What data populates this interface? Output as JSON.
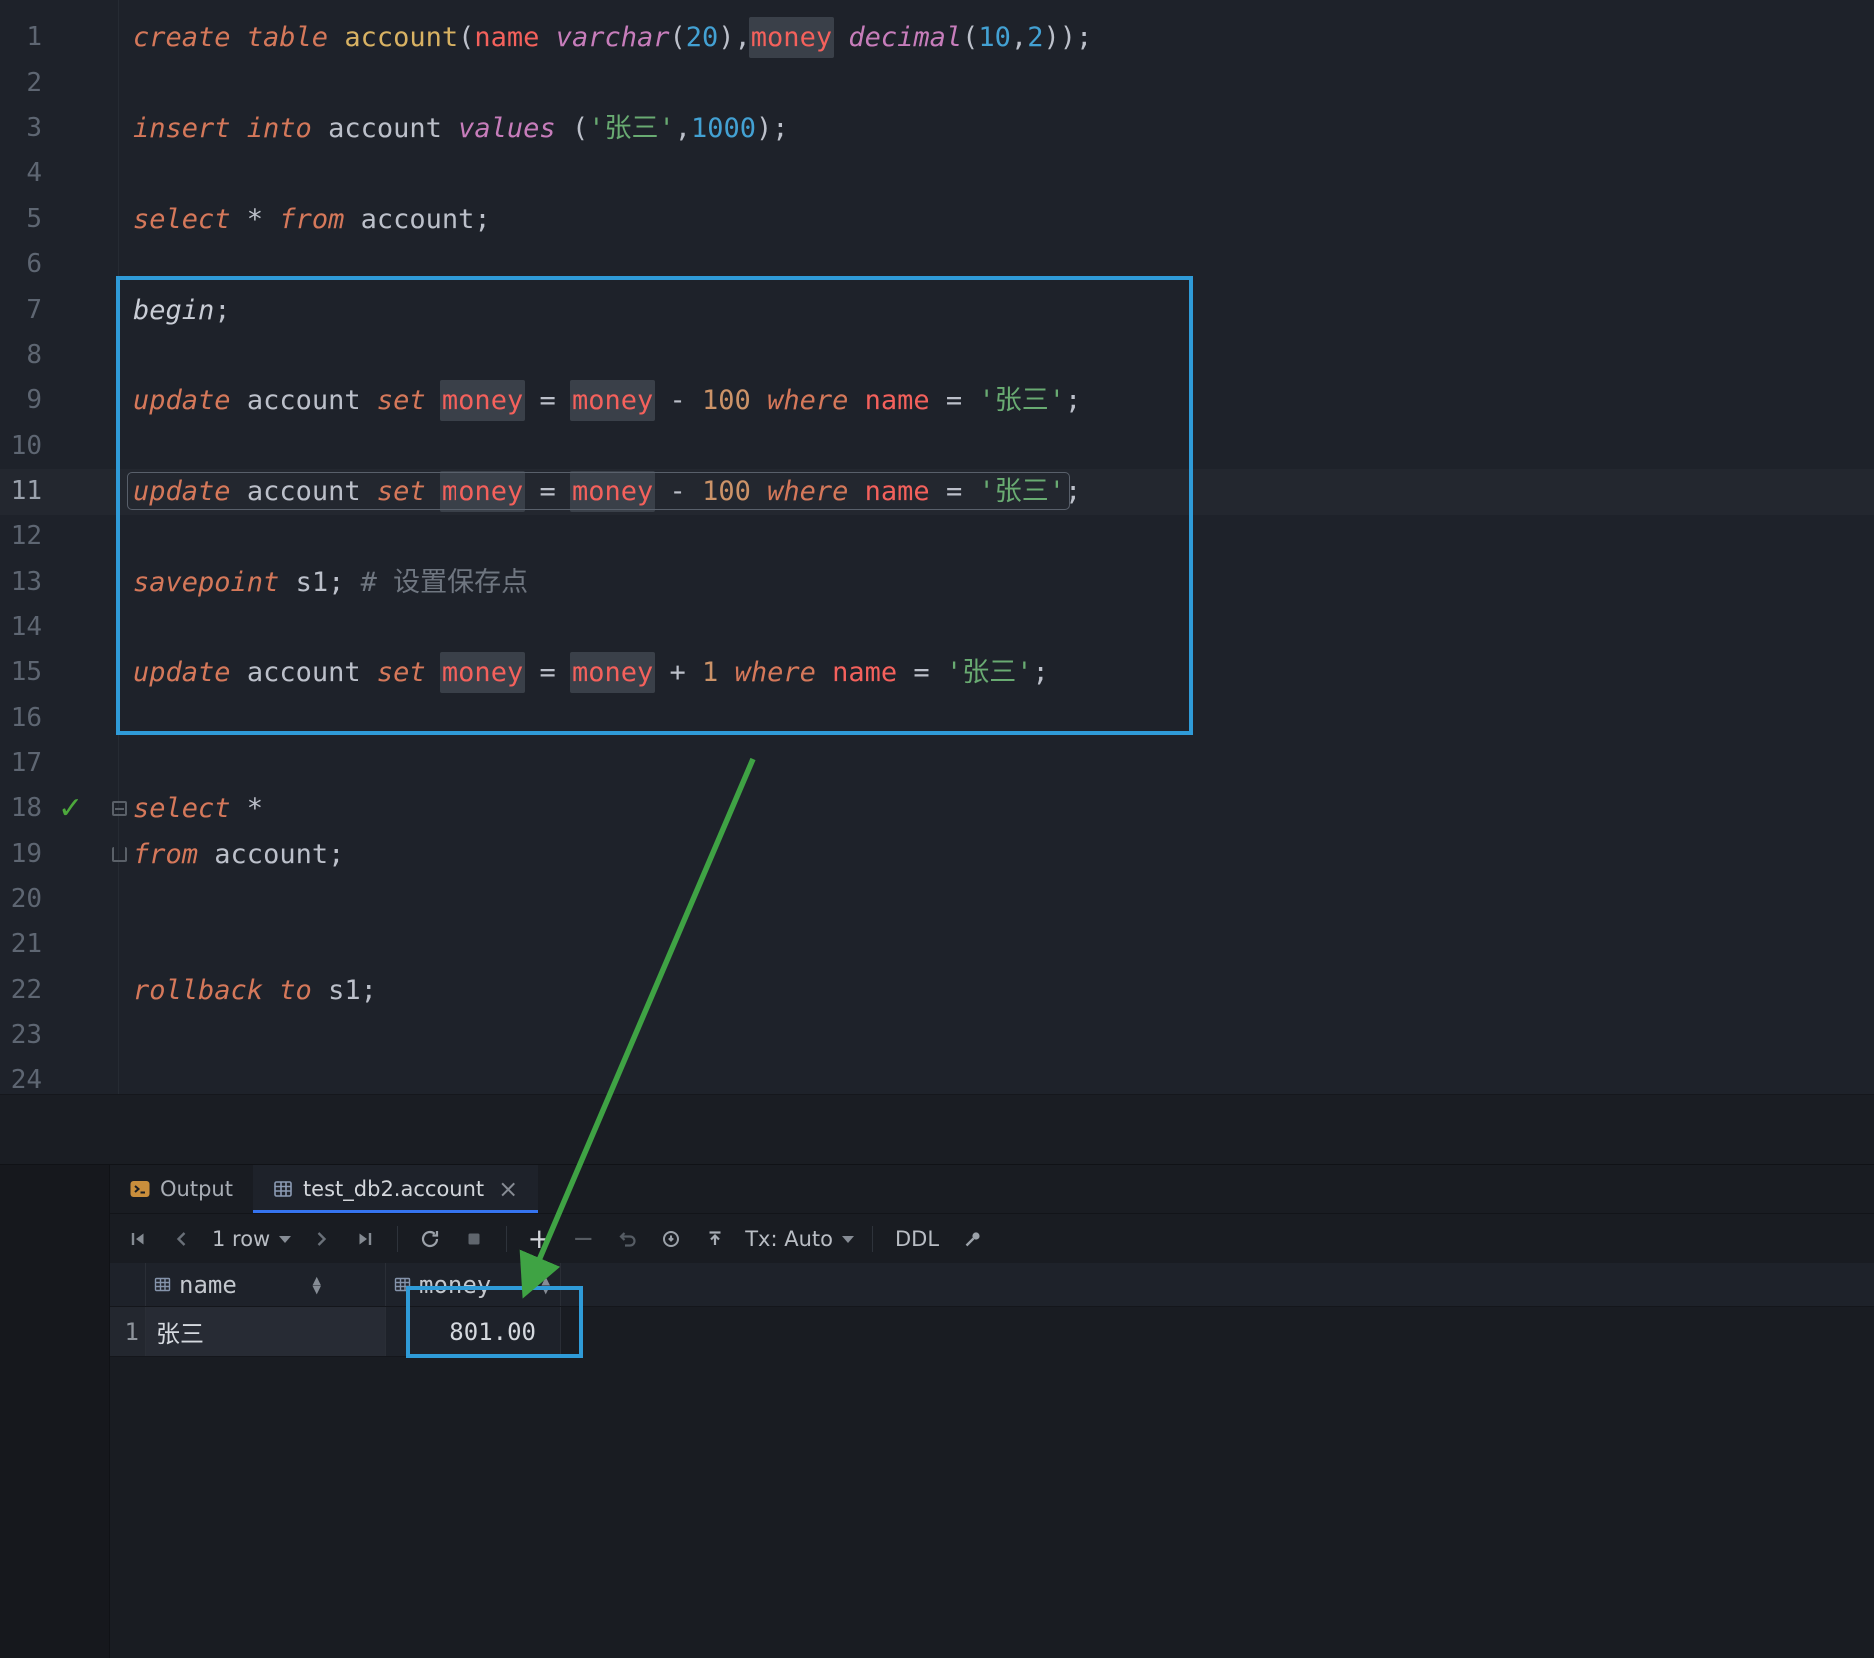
{
  "colors": {
    "editor_bg": "#1E222A",
    "annotation_blue": "#2F9BD8",
    "annotation_green": "#3FA344",
    "keyword": "#D5785A",
    "type_keyword": "#C77DBB",
    "string": "#69AB72",
    "number": "#43A1D3",
    "number_warm": "#CC9368",
    "column": "#F4615C",
    "table_name": "#D8B263",
    "comment": "#6F7680",
    "active_tab_accent": "#3574F0",
    "success_check": "#4DA83C"
  },
  "icons": {
    "close": "×",
    "check": "✓",
    "sort_up": "▲",
    "sort_down": "▼",
    "plus": "+",
    "minus": "−"
  },
  "editor": {
    "total_lines": 24,
    "caret_line": 11,
    "check_line": 18,
    "marker_lines": [
      18,
      19
    ],
    "lines": [
      {
        "n": 1,
        "tokens": [
          [
            "create table",
            "kw"
          ],
          [
            " ",
            "pl"
          ],
          [
            "account",
            "tbl"
          ],
          [
            "(",
            "pl"
          ],
          [
            "name",
            "col"
          ],
          [
            " ",
            "pl"
          ],
          [
            "varchar",
            "typ"
          ],
          [
            "(",
            "pl"
          ],
          [
            "20",
            "num"
          ],
          [
            "),",
            "pl"
          ],
          [
            "money",
            "colh"
          ],
          [
            " ",
            "pl"
          ],
          [
            "decimal",
            "typ"
          ],
          [
            "(",
            "pl"
          ],
          [
            "10",
            "num"
          ],
          [
            ",",
            "pl"
          ],
          [
            "2",
            "num"
          ],
          [
            "));",
            "pl"
          ]
        ]
      },
      {
        "n": 3,
        "tokens": [
          [
            "insert into",
            "kw"
          ],
          [
            " ",
            "pl"
          ],
          [
            "account",
            "pl"
          ],
          [
            " ",
            "pl"
          ],
          [
            "values",
            "typ"
          ],
          [
            " (",
            "pl"
          ],
          [
            "'张三'",
            "str"
          ],
          [
            ",",
            "pl"
          ],
          [
            "1000",
            "num"
          ],
          [
            ");",
            "pl"
          ]
        ]
      },
      {
        "n": 5,
        "tokens": [
          [
            "select",
            "kw"
          ],
          [
            " * ",
            "pl"
          ],
          [
            "from",
            "kw"
          ],
          [
            " ",
            "pl"
          ],
          [
            "account;",
            "pl"
          ]
        ]
      },
      {
        "n": 7,
        "tokens": [
          [
            "begin",
            "itl"
          ],
          [
            ";",
            "pl"
          ]
        ]
      },
      {
        "n": 9,
        "tokens": [
          [
            "update",
            "kw"
          ],
          [
            " ",
            "pl"
          ],
          [
            "account",
            "pl"
          ],
          [
            " ",
            "pl"
          ],
          [
            "set",
            "kw"
          ],
          [
            " ",
            "pl"
          ],
          [
            "money",
            "colh"
          ],
          [
            " = ",
            "pl"
          ],
          [
            "money",
            "colh"
          ],
          [
            " - ",
            "pl"
          ],
          [
            "100",
            "num2"
          ],
          [
            " ",
            "pl"
          ],
          [
            "where",
            "kw"
          ],
          [
            " ",
            "pl"
          ],
          [
            "name",
            "col"
          ],
          [
            " = ",
            "pl"
          ],
          [
            "'张三'",
            "str"
          ],
          [
            ";",
            "pl"
          ]
        ]
      },
      {
        "n": 11,
        "outline": [
          [
            "update",
            "kw"
          ],
          [
            " ",
            "pl"
          ],
          [
            "account",
            "pl"
          ],
          [
            " ",
            "pl"
          ],
          [
            "set",
            "kw"
          ],
          [
            " ",
            "pl"
          ],
          [
            "m",
            "colh"
          ],
          [
            "",
            "caret"
          ],
          [
            "oney",
            "colh"
          ],
          [
            " = ",
            "pl"
          ],
          [
            "money",
            "colh"
          ],
          [
            " - ",
            "pl"
          ],
          [
            "100",
            "num2"
          ],
          [
            " ",
            "pl"
          ],
          [
            "where",
            "kw"
          ],
          [
            " ",
            "pl"
          ],
          [
            "name",
            "col"
          ],
          [
            " = ",
            "pl"
          ],
          [
            "'张三'",
            "str"
          ]
        ],
        "tail": [
          [
            ";",
            "pl"
          ]
        ]
      },
      {
        "n": 13,
        "tokens": [
          [
            "savepoint",
            "kw"
          ],
          [
            " ",
            "pl"
          ],
          [
            "s1; ",
            "pl"
          ],
          [
            "# 设置保存点",
            "cmt"
          ]
        ]
      },
      {
        "n": 15,
        "tokens": [
          [
            "update",
            "kw"
          ],
          [
            " ",
            "pl"
          ],
          [
            "account",
            "pl"
          ],
          [
            " ",
            "pl"
          ],
          [
            "set",
            "kw"
          ],
          [
            " ",
            "pl"
          ],
          [
            "money",
            "colh"
          ],
          [
            " = ",
            "pl"
          ],
          [
            "money",
            "colh"
          ],
          [
            " + ",
            "pl"
          ],
          [
            "1",
            "num2"
          ],
          [
            " ",
            "pl"
          ],
          [
            "where",
            "kw"
          ],
          [
            " ",
            "pl"
          ],
          [
            "name",
            "col"
          ],
          [
            " = ",
            "pl"
          ],
          [
            "'张三'",
            "str"
          ],
          [
            ";",
            "pl"
          ]
        ]
      },
      {
        "n": 18,
        "tokens": [
          [
            "select",
            "kw"
          ],
          [
            " *",
            "pl"
          ]
        ]
      },
      {
        "n": 19,
        "tokens": [
          [
            "from",
            "kw"
          ],
          [
            " ",
            "pl"
          ],
          [
            "account;",
            "pl"
          ]
        ]
      },
      {
        "n": 22,
        "tokens": [
          [
            "rollback to",
            "kw"
          ],
          [
            " ",
            "pl"
          ],
          [
            "s1;",
            "pl"
          ]
        ]
      }
    ]
  },
  "panel": {
    "tabs": [
      {
        "label": "Output"
      },
      {
        "label": "test_db2.account",
        "active": true
      }
    ],
    "toolbar": {
      "pager": "1 row",
      "tx": "Tx: Auto",
      "ddl": "DDL"
    },
    "table": {
      "columns": [
        {
          "label": "name",
          "align": "left"
        },
        {
          "label": "money",
          "align": "right"
        }
      ],
      "rows": [
        {
          "num": "1",
          "cells": [
            "张三",
            "801.00"
          ]
        }
      ]
    }
  }
}
